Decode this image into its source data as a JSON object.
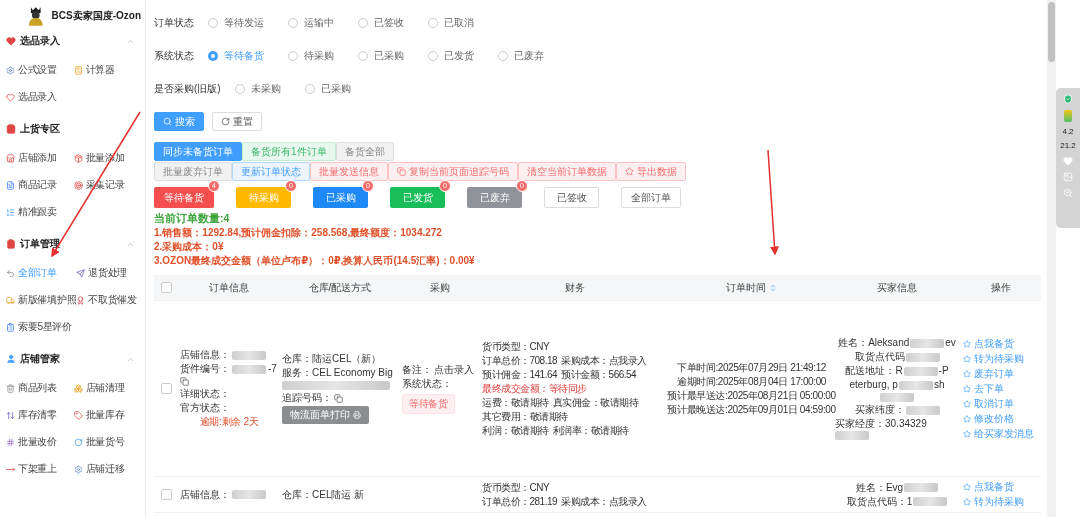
{
  "sidebar": {
    "title": "BCS卖家国度-Ozon",
    "sections": [
      {
        "title": "选品录入",
        "expanded": true,
        "items": [
          {
            "label": "公式设置",
            "selected": false
          },
          {
            "label": "计算器",
            "selected": false
          },
          {
            "label": "选品录入",
            "selected": false
          }
        ]
      },
      {
        "title": "上货专区",
        "expanded": true,
        "items": [
          {
            "label": "店铺添加",
            "selected": false
          },
          {
            "label": "批量添加",
            "selected": false
          },
          {
            "label": "商品记录",
            "selected": false
          },
          {
            "label": "采集记录",
            "selected": false
          },
          {
            "label": "精准跟卖",
            "selected": false
          }
        ]
      },
      {
        "title": "订单管理",
        "expanded": true,
        "items": [
          {
            "label": "全部订单",
            "selected": true
          },
          {
            "label": "退货处理",
            "selected": false
          },
          {
            "label": "新版催填护照",
            "selected": false
          },
          {
            "label": "不取货催发",
            "selected": false
          },
          {
            "label": "索要5星评价",
            "selected": false
          }
        ]
      },
      {
        "title": "店铺管家",
        "expanded": true,
        "items": [
          {
            "label": "商品列表",
            "selected": false
          },
          {
            "label": "店铺清理",
            "selected": false
          },
          {
            "label": "库存清零",
            "selected": false
          },
          {
            "label": "批量库存",
            "selected": false
          },
          {
            "label": "批量改价",
            "selected": false
          },
          {
            "label": "批量货号",
            "selected": false
          },
          {
            "label": "下架重上",
            "selected": false
          },
          {
            "label": "店铺迁移",
            "selected": false
          }
        ]
      }
    ]
  },
  "filters": [
    {
      "label": "订单状态",
      "options": [
        {
          "label": "等待发运",
          "selected": false
        },
        {
          "label": "运输中",
          "selected": false
        },
        {
          "label": "已签收",
          "selected": false
        },
        {
          "label": "已取消",
          "selected": false
        }
      ]
    },
    {
      "label": "系统状态",
      "options": [
        {
          "label": "等待备货",
          "selected": true
        },
        {
          "label": "待采购",
          "selected": false
        },
        {
          "label": "已采购",
          "selected": false
        },
        {
          "label": "已发货",
          "selected": false
        },
        {
          "label": "已废弃",
          "selected": false
        }
      ]
    },
    {
      "label": "是否采购(旧版)",
      "options": [
        {
          "label": "未采购",
          "selected": false
        },
        {
          "label": "已采购",
          "selected": false
        }
      ]
    }
  ],
  "search_button": "搜索",
  "reset_button": "重置",
  "action_rows": [
    [
      {
        "label": "同步未备货订单",
        "kind": "primary"
      },
      {
        "label": "备货所有1件订单",
        "kind": "success"
      },
      {
        "label": "备货全部",
        "kind": "muted"
      }
    ],
    [
      {
        "label": "批量废弃订单",
        "kind": "muted"
      },
      {
        "label": "更新订单状态",
        "kind": "info"
      },
      {
        "label": "批量发送信息",
        "kind": "danger"
      },
      {
        "label": "复制当前页面追踪号码",
        "kind": "danger-copy"
      },
      {
        "label": "清空当前订单数据",
        "kind": "danger"
      },
      {
        "label": "导出数据",
        "kind": "danger-star"
      }
    ]
  ],
  "status_buttons": [
    {
      "label": "等待备货",
      "count": "4",
      "kind": "danger"
    },
    {
      "label": "待采购",
      "count": "0",
      "kind": "warning"
    },
    {
      "label": "已采购",
      "count": "0",
      "kind": "primary"
    },
    {
      "label": "已发货",
      "count": "0",
      "kind": "success"
    },
    {
      "label": "已废弃",
      "count": "0",
      "kind": "info"
    },
    {
      "label": "已签收",
      "kind": "plain"
    },
    {
      "label": "全部订单",
      "kind": "plain"
    }
  ],
  "order_count": "当前订单数量:4",
  "summary_lines": [
    "1.销售额：1292.84,预计佣金扣除：258.568,最终额度：1034.272",
    "2.采购成本：0¥",
    "3.OZON最终成交金额（单位卢布₽）：0₽,换算人民币(14.5汇率)：0.00¥"
  ],
  "table": {
    "select_all": false,
    "columns": [
      {
        "label": "订单信息",
        "sortable": false
      },
      {
        "label": "仓库/配送方式",
        "sortable": false
      },
      {
        "label": "采购",
        "sortable": false
      },
      {
        "label": "财务",
        "sortable": false
      },
      {
        "label": "订单时间",
        "sortable": true
      },
      {
        "label": "买家信息",
        "sortable": false
      },
      {
        "label": "操作",
        "sortable": false
      }
    ],
    "rows": [
      {
        "selected": false,
        "order_info": [
          [
            {
              "kind": "text",
              "text": "店铺信息："
            },
            {
              "kind": "blur",
              "wide": false
            }
          ],
          [
            {
              "kind": "text",
              "text": "货件编号："
            },
            {
              "kind": "blur",
              "wide": false
            },
            {
              "kind": "text",
              "text": "-7"
            },
            {
              "kind": "copy"
            }
          ],
          [
            {
              "kind": "text",
              "text": "详细状态："
            }
          ],
          [
            {
              "kind": "text",
              "text": "官方状态："
            }
          ]
        ],
        "deadline": "逾期:剩余 2天",
        "warehouse": [
          [
            {
              "kind": "text",
              "text": "仓库：陆运CEL（新）"
            }
          ],
          [
            {
              "kind": "text",
              "text": "服务：CEL Economy Big"
            }
          ],
          [
            {
              "kind": "blur",
              "wide": true
            }
          ],
          [
            {
              "kind": "text",
              "text": "追踪号码："
            },
            {
              "kind": "copy"
            }
          ]
        ],
        "print_button": "物流面单打印",
        "purchase": {
          "note_label": "备注：",
          "note_value": "点击录入",
          "status_label": "系统状态：",
          "status_tag": "等待备货"
        },
        "finance": [
          [
            {
              "text": "货币类型：CNY",
              "alert": false
            }
          ],
          [
            {
              "text": "订单总价：708.18",
              "alert": false
            },
            {
              "text": "采购成本：点我录入",
              "alert": false
            }
          ],
          [
            {
              "text": "预计佣金：141.64",
              "alert": false
            },
            {
              "text": "预计金额：566.54",
              "alert": false
            }
          ],
          [
            {
              "text": "最终成交金额：等待同步",
              "alert": true
            }
          ],
          [
            {
              "text": "运费：敬请期待",
              "alert": false
            },
            {
              "text": "真实佣金：敬请期待",
              "alert": false
            }
          ],
          [
            {
              "text": "其它费用：敬请期待",
              "alert": false
            }
          ],
          [
            {
              "text": "利润：敬请期待",
              "alert": false
            },
            {
              "text": "利润率：敬请期待",
              "alert": false
            }
          ]
        ],
        "times": [
          "下单时间:2025年07月29日 21:49:12",
          "逾期时间:2025年08月04日 17:00:00",
          "预计最早送达:2025年08月21日 05:00:00",
          "预计最晚送达:2025年09月01日 04:59:00"
        ],
        "buyer": [
          [
            {
              "kind": "text",
              "text": "姓名：Aleksand"
            },
            {
              "kind": "blur",
              "wide": false
            },
            {
              "kind": "text",
              "text": "ev"
            }
          ],
          [
            {
              "kind": "text",
              "text": "取货点代码"
            },
            {
              "kind": "blur",
              "wide": false
            }
          ],
          [
            {
              "kind": "text",
              "text": "配送地址：R"
            },
            {
              "kind": "blur",
              "wide": false
            },
            {
              "kind": "text",
              "text": "-P"
            }
          ],
          [
            {
              "kind": "text",
              "text": "eterburg, p"
            },
            {
              "kind": "blur",
              "wide": false
            },
            {
              "kind": "text",
              "text": "sh"
            }
          ],
          [
            {
              "kind": "blur",
              "wide": false
            }
          ],
          [
            {
              "kind": "text",
              "text": "买家纬度："
            },
            {
              "kind": "blur",
              "wide": false
            }
          ],
          [
            {
              "kind": "text",
              "text": "买家经度：30.34329"
            },
            {
              "kind": "blur",
              "wide": false
            }
          ]
        ],
        "actions": [
          "点我备货",
          "转为待采购",
          "废弃订单",
          "去下单",
          "取消订单",
          "修改价格",
          "给买家发消息"
        ]
      },
      {
        "selected": false,
        "order_info": [
          [
            {
              "kind": "text",
              "text": "店铺信息："
            },
            {
              "kind": "blur",
              "wide": false
            }
          ]
        ],
        "warehouse": [
          [
            {
              "kind": "text",
              "text": "仓库：CEL陆运 新"
            }
          ]
        ],
        "finance": [
          [
            {
              "text": "货币类型：CNY",
              "alert": false
            }
          ],
          [
            {
              "text": "订单总价：281.19",
              "alert": false
            },
            {
              "text": "采购成本：点我录入",
              "alert": false
            }
          ]
        ],
        "times": [],
        "buyer": [
          [
            {
              "kind": "text",
              "text": "姓名：Evg"
            },
            {
              "kind": "blur",
              "wide": false
            }
          ],
          [
            {
              "kind": "text",
              "text": "取货点代码：1"
            },
            {
              "kind": "blur",
              "wide": false
            }
          ]
        ],
        "actions": [
          "点我备货",
          "转为待采购"
        ]
      }
    ]
  },
  "speed_widget": {
    "upload": "4.2",
    "download": "21.2"
  }
}
